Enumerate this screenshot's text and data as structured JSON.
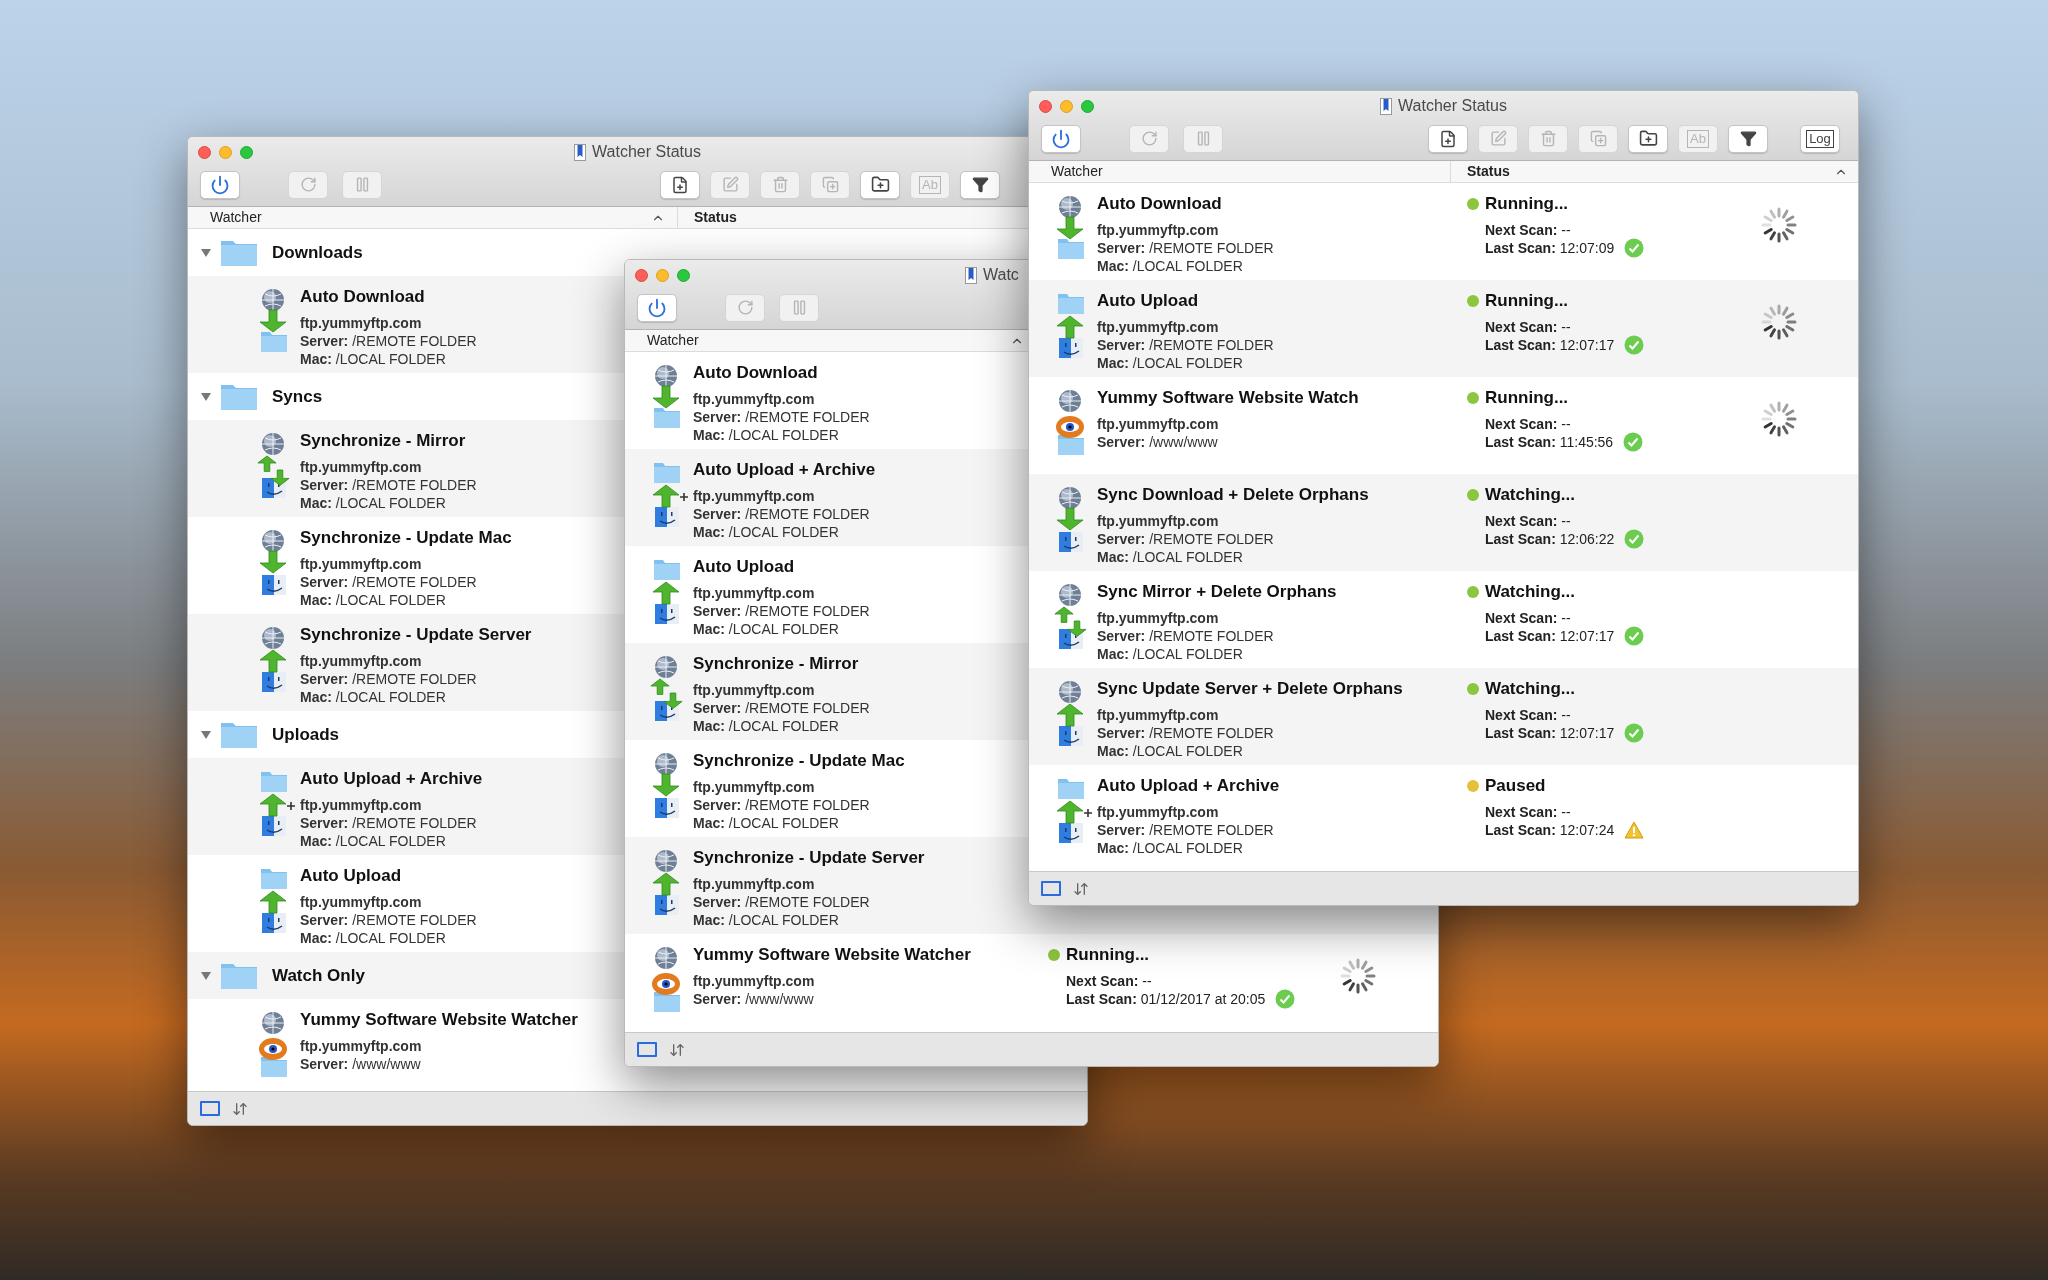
{
  "windows": [
    {
      "title": "Watcher Status",
      "toolbar": [
        {
          "kind": "power",
          "disabled": false
        },
        {
          "kind": "refresh",
          "disabled": true
        },
        {
          "kind": "pause",
          "disabled": true
        },
        {
          "kind": "new",
          "disabled": false
        },
        {
          "kind": "edit",
          "disabled": true
        },
        {
          "kind": "delete",
          "disabled": true
        },
        {
          "kind": "duplicate",
          "disabled": true
        },
        {
          "kind": "new-folder",
          "disabled": false
        },
        {
          "kind": "rename",
          "disabled": true,
          "label": "Ab"
        },
        {
          "kind": "filter",
          "disabled": false
        }
      ],
      "columns": [
        "Watcher",
        "Status"
      ],
      "groups": [
        {
          "label": "Downloads",
          "expanded": true,
          "children": [
            {
              "kind": "download",
              "name": "Auto Download",
              "host": "ftp.yummyftp.com",
              "details": [
                "**Server:** /REMOTE FOLDER",
                "**Mac:** /LOCAL FOLDER"
              ]
            }
          ]
        },
        {
          "label": "Syncs",
          "expanded": true,
          "children": [
            {
              "kind": "mirror",
              "name": "Synchronize - Mirror",
              "host": "ftp.yummyftp.com",
              "details": [
                "**Server:** /REMOTE FOLDER",
                "**Mac:** /LOCAL FOLDER"
              ]
            },
            {
              "kind": "update-mac",
              "name": "Synchronize - Update Mac",
              "host": "ftp.yummyftp.com",
              "details": [
                "**Server:** /REMOTE FOLDER",
                "**Mac:** /LOCAL FOLDER"
              ]
            },
            {
              "kind": "update-server",
              "name": "Synchronize - Update Server",
              "host": "ftp.yummyftp.com",
              "details": [
                "**Server:** /REMOTE FOLDER",
                "**Mac:** /LOCAL FOLDER"
              ]
            }
          ]
        },
        {
          "label": "Uploads",
          "expanded": true,
          "children": [
            {
              "kind": "upload-archive",
              "name": "Auto Upload + Archive",
              "host": "ftp.yummyftp.com",
              "details": [
                "**Server:** /REMOTE FOLDER",
                "**Mac:** /LOCAL FOLDER"
              ]
            },
            {
              "kind": "upload",
              "name": "Auto Upload",
              "host": "ftp.yummyftp.com",
              "details": [
                "**Server:** /REMOTE FOLDER",
                "**Mac:** /LOCAL FOLDER"
              ]
            }
          ]
        },
        {
          "label": "Watch Only",
          "expanded": true,
          "children": [
            {
              "kind": "watch",
              "name": "Yummy Software Website Watcher",
              "host": "ftp.yummyftp.com",
              "details": [
                "**Server:** /www/www"
              ]
            }
          ]
        }
      ]
    },
    {
      "title": "Watc",
      "toolbar": [
        {
          "kind": "power",
          "disabled": false
        },
        {
          "kind": "refresh",
          "disabled": true
        },
        {
          "kind": "pause",
          "disabled": true
        }
      ],
      "columns": [
        "Watcher"
      ],
      "watchers": [
        {
          "kind": "download",
          "name": "Auto Download",
          "host": "ftp.yummyftp.com",
          "details": [
            "**Server:** /REMOTE FOLDER",
            "**Mac:** /LOCAL FOLDER"
          ]
        },
        {
          "kind": "upload-archive",
          "name": "Auto Upload + Archive",
          "host": "ftp.yummyftp.com",
          "details": [
            "**Server:** /REMOTE FOLDER",
            "**Mac:** /LOCAL FOLDER"
          ]
        },
        {
          "kind": "upload",
          "name": "Auto Upload",
          "host": "ftp.yummyftp.com",
          "details": [
            "**Server:** /REMOTE FOLDER",
            "**Mac:** /LOCAL FOLDER"
          ]
        },
        {
          "kind": "mirror",
          "name": "Synchronize - Mirror",
          "host": "ftp.yummyftp.com",
          "details": [
            "**Server:** /REMOTE FOLDER",
            "**Mac:** /LOCAL FOLDER"
          ]
        },
        {
          "kind": "update-mac",
          "name": "Synchronize - Update Mac",
          "host": "ftp.yummyftp.com",
          "details": [
            "**Server:** /REMOTE FOLDER",
            "**Mac:** /LOCAL FOLDER"
          ]
        },
        {
          "kind": "update-server",
          "name": "Synchronize - Update Server",
          "host": "ftp.yummyftp.com",
          "details": [
            "**Server:** /REMOTE FOLDER",
            "**Mac:** /LOCAL FOLDER"
          ]
        },
        {
          "kind": "watch",
          "name": "Yummy Software Website Watcher",
          "host": "ftp.yummyftp.com",
          "details": [
            "**Server:** /www/www"
          ],
          "status": {
            "color": "#8cc63f",
            "text": "Running...",
            "lines": [
              "**Next Scan:** --",
              "**Last Scan:** 01/12/2017 at 20:05"
            ],
            "ok": true,
            "busy": true
          }
        }
      ]
    },
    {
      "title": "Watcher Status",
      "toolbar": [
        {
          "kind": "power",
          "disabled": false
        },
        {
          "kind": "refresh",
          "disabled": true
        },
        {
          "kind": "pause",
          "disabled": true
        },
        {
          "kind": "new",
          "disabled": false
        },
        {
          "kind": "edit",
          "disabled": true
        },
        {
          "kind": "delete",
          "disabled": true
        },
        {
          "kind": "duplicate",
          "disabled": true
        },
        {
          "kind": "new-folder",
          "disabled": false
        },
        {
          "kind": "rename",
          "disabled": true,
          "label": "Ab"
        },
        {
          "kind": "filter",
          "disabled": false
        },
        {
          "kind": "log",
          "disabled": false,
          "label": "Log"
        }
      ],
      "columns": [
        "Watcher",
        "Status"
      ],
      "watchers": [
        {
          "kind": "download",
          "name": "Auto Download",
          "host": "ftp.yummyftp.com",
          "details": [
            "**Server:** /REMOTE FOLDER",
            "**Mac:** /LOCAL FOLDER"
          ],
          "status": {
            "color": "#8cc63f",
            "text": "Running...",
            "lines": [
              "**Next Scan:** --",
              "**Last Scan:** 12:07:09"
            ],
            "ok": true,
            "busy": true
          }
        },
        {
          "kind": "upload",
          "name": "Auto Upload",
          "host": "ftp.yummyftp.com",
          "details": [
            "**Server:** /REMOTE FOLDER",
            "**Mac:** /LOCAL FOLDER"
          ],
          "status": {
            "color": "#8cc63f",
            "text": "Running...",
            "lines": [
              "**Next Scan:** --",
              "**Last Scan:** 12:07:17"
            ],
            "ok": true,
            "busy": true
          }
        },
        {
          "kind": "watch",
          "name": "Yummy Software Website Watch",
          "host": "ftp.yummyftp.com",
          "details": [
            "**Server:** /www/www"
          ],
          "status": {
            "color": "#8cc63f",
            "text": "Running...",
            "lines": [
              "**Next Scan:** --",
              "**Last Scan:** 11:45:56"
            ],
            "ok": true,
            "busy": true
          }
        },
        {
          "kind": "update-mac",
          "name": "Sync Download + Delete Orphans",
          "host": "ftp.yummyftp.com",
          "details": [
            "**Server:** /REMOTE FOLDER",
            "**Mac:** /LOCAL FOLDER"
          ],
          "status": {
            "color": "#8cc63f",
            "text": "Watching...",
            "lines": [
              "**Next Scan:** --",
              "**Last Scan:** 12:06:22"
            ],
            "ok": true,
            "busy": false
          }
        },
        {
          "kind": "mirror",
          "name": "Sync Mirror + Delete Orphans",
          "host": "ftp.yummyftp.com",
          "details": [
            "**Server:** /REMOTE FOLDER",
            "**Mac:** /LOCAL FOLDER"
          ],
          "status": {
            "color": "#8cc63f",
            "text": "Watching...",
            "lines": [
              "**Next Scan:** --",
              "**Last Scan:** 12:07:17"
            ],
            "ok": true,
            "busy": false
          }
        },
        {
          "kind": "update-server",
          "name": "Sync Update Server + Delete Orphans",
          "host": "ftp.yummyftp.com",
          "details": [
            "**Server:** /REMOTE FOLDER",
            "**Mac:** /LOCAL FOLDER"
          ],
          "status": {
            "color": "#8cc63f",
            "text": "Watching...",
            "lines": [
              "**Next Scan:** --",
              "**Last Scan:** 12:07:17"
            ],
            "ok": true,
            "busy": false
          }
        },
        {
          "kind": "upload-archive",
          "name": "Auto Upload + Archive",
          "host": "ftp.yummyftp.com",
          "details": [
            "**Server:** /REMOTE FOLDER",
            "**Mac:** /LOCAL FOLDER"
          ],
          "status": {
            "color": "#e3c23a",
            "text": "Paused",
            "lines": [
              "**Next Scan:** --",
              "**Last Scan:** 12:07:24"
            ],
            "ok": false,
            "busy": false
          }
        }
      ]
    }
  ]
}
